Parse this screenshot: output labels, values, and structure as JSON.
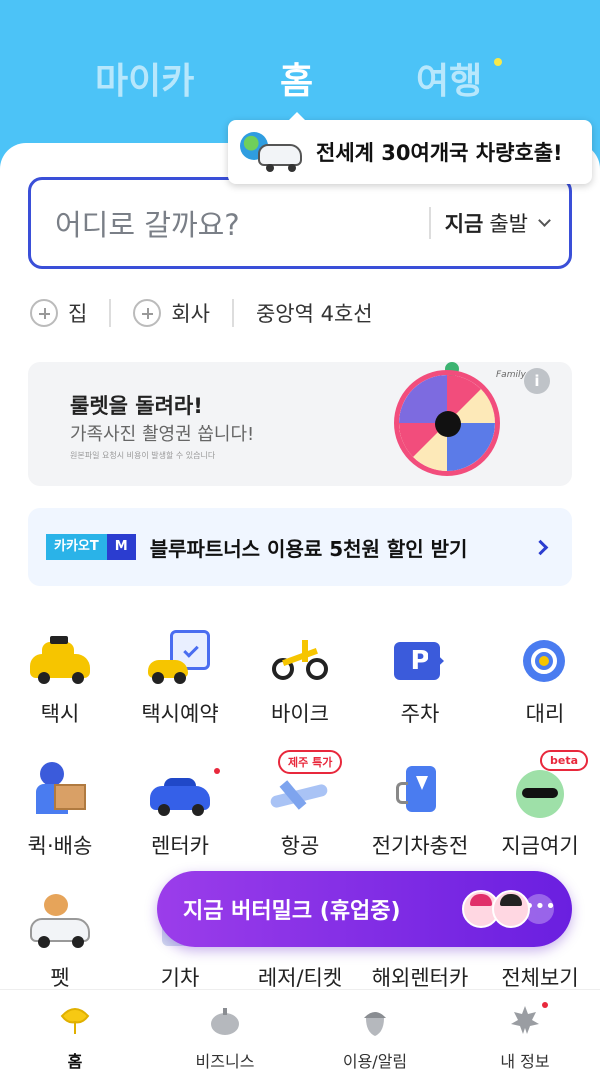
{
  "top_tabs": {
    "my_car": "마이카",
    "home": "홈",
    "travel": "여행"
  },
  "tooltip": {
    "text": "전세계 30여개국 차량호출!"
  },
  "search": {
    "placeholder": "어디로 갈까요?",
    "depart_bold": "지금",
    "depart_rest": "출발"
  },
  "shortcuts": {
    "home": "집",
    "work": "회사",
    "recent": "중앙역 4호선"
  },
  "roulette_banner": {
    "title": "룰렛을 돌려라!",
    "subtitle": "가족사진 촬영권 쏩니다!",
    "fine_print": "원본파일 요청시 비용이 발생할 수 있습니다",
    "brand": "Family",
    "info": "i"
  },
  "promo": {
    "badge_left": "카카오T",
    "badge_right": "M",
    "text": "블루파트너스 이용료 5천원 할인 받기"
  },
  "services": {
    "taxi": "택시",
    "taxi_reserve": "택시예약",
    "bike": "바이크",
    "parking": "주차",
    "parking_glyph": "P",
    "driver": "대리",
    "quick": "퀵·배송",
    "rentcar": "렌터카",
    "flight": "항공",
    "flight_tag": "제주 특가",
    "ev_charge": "전기차충전",
    "here_now": "지금여기",
    "here_now_tag": "beta",
    "pet": "펫",
    "train": "기차",
    "leisure": "레저/티켓",
    "overseas_rent": "해외렌터카",
    "all": "전체보기"
  },
  "live_button": {
    "text": "지금 버터밀크 (휴업중)",
    "more": "•••"
  },
  "bottom_nav": {
    "home": "홈",
    "business": "비즈니스",
    "usage": "이용/알림",
    "my_info": "내 정보"
  },
  "colors": {
    "header_bg": "#4cc3f7",
    "accent_blue": "#3a4fd8",
    "live_purple": "#8a2ee6",
    "taxi_yellow": "#f6c500",
    "ginkgo": "#f7c913"
  }
}
